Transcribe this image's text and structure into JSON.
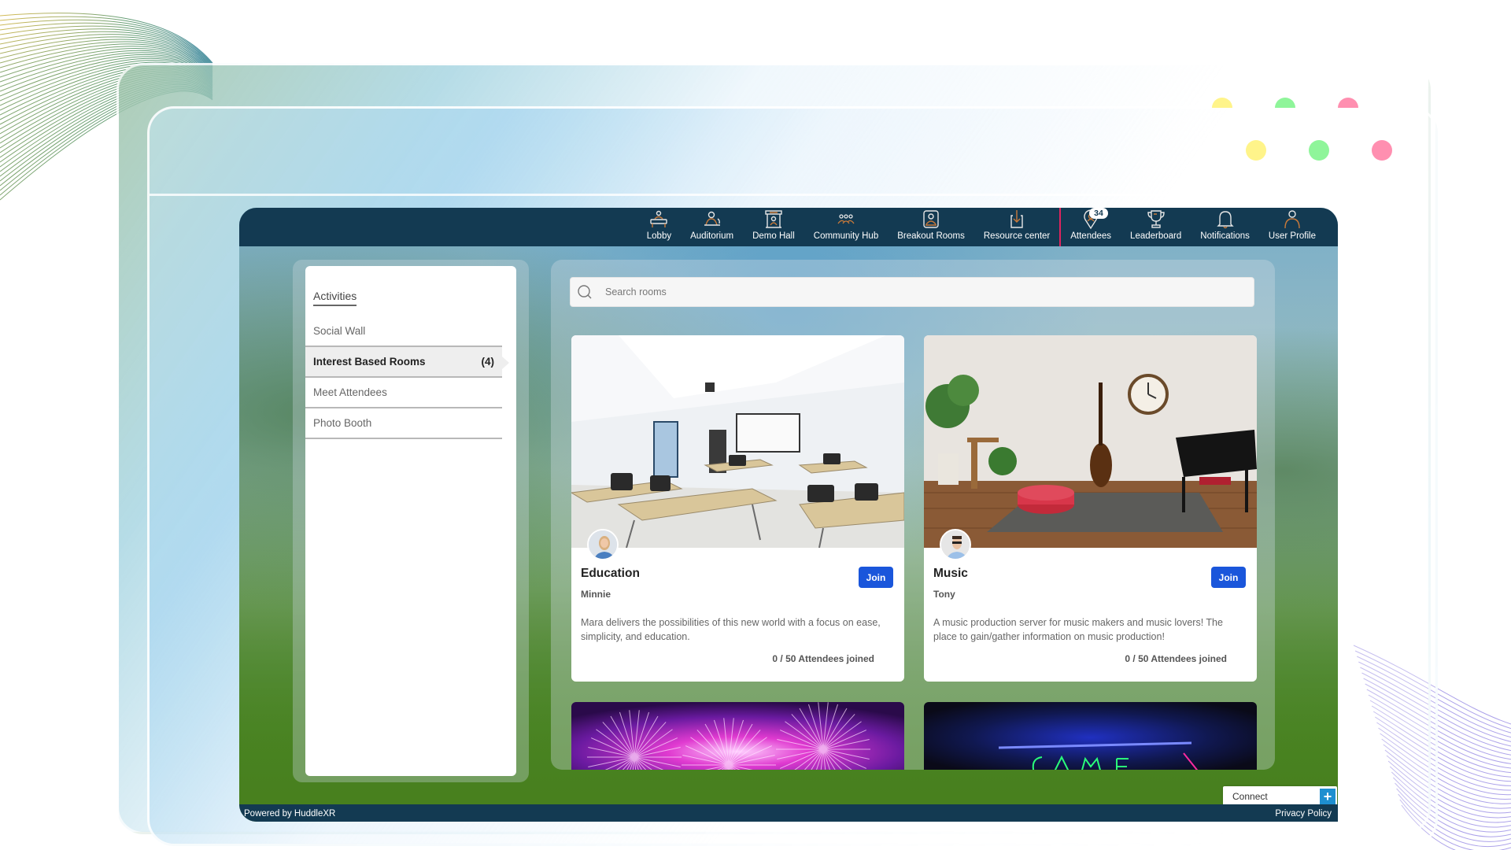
{
  "nav": {
    "items": [
      {
        "id": "lobby",
        "label": "Lobby",
        "icon": "lobby-desk-icon"
      },
      {
        "id": "auditorium",
        "label": "Auditorium",
        "icon": "auditorium-speaker-icon"
      },
      {
        "id": "demo-hall",
        "label": "Demo Hall",
        "icon": "demo-booth-icon"
      },
      {
        "id": "community-hub",
        "label": "Community Hub",
        "icon": "community-group-icon"
      },
      {
        "id": "breakout-rooms",
        "label": "Breakout Rooms",
        "icon": "breakout-room-icon"
      },
      {
        "id": "resource-center",
        "label": "Resource center",
        "icon": "download-box-icon"
      }
    ],
    "right_items": [
      {
        "id": "attendees",
        "label": "Attendees",
        "icon": "attendees-pin-icon",
        "badge": "34"
      },
      {
        "id": "leaderboard",
        "label": "Leaderboard",
        "icon": "trophy-icon"
      },
      {
        "id": "notifications",
        "label": "Notifications",
        "icon": "bell-icon"
      },
      {
        "id": "user-profile",
        "label": "User Profile",
        "icon": "user-icon"
      }
    ]
  },
  "sidebar": {
    "title": "Activities",
    "items": [
      {
        "label": "Social Wall",
        "count": "",
        "active": false
      },
      {
        "label": "Interest Based Rooms",
        "count": "(4)",
        "active": true
      },
      {
        "label": "Meet Attendees",
        "count": "",
        "active": false
      },
      {
        "label": "Photo Booth",
        "count": "",
        "active": false
      }
    ]
  },
  "search": {
    "placeholder": "Search rooms",
    "value": ""
  },
  "rooms": [
    {
      "title": "Education",
      "host": "Minnie",
      "description": "Mara delivers the possibilities of this new world with a focus on ease, simplicity, and education.",
      "attendees": "0 / 50 Attendees joined",
      "join_label": "Join",
      "image": "classroom"
    },
    {
      "title": "Music",
      "host": "Tony",
      "description": "A music production server for music makers and music lovers! The place to gain/gather information on music production!",
      "attendees": "0 / 50 Attendees joined",
      "join_label": "Join",
      "image": "music-room"
    },
    {
      "image": "fireworks"
    },
    {
      "image": "neon-game-sign"
    }
  ],
  "connect": {
    "label": "Connect",
    "icon": "plus-icon"
  },
  "footer": {
    "powered_by": "Powered by HuddleXR",
    "privacy": "Privacy Policy"
  },
  "colors": {
    "navbar": "#133a52",
    "accent_icon": "#c97a3a",
    "join_button": "#1a56db",
    "separator": "#e0245e",
    "dot_yellow": "#fff48a",
    "dot_green": "#8ff59a",
    "dot_pink": "#ff8fb0"
  }
}
